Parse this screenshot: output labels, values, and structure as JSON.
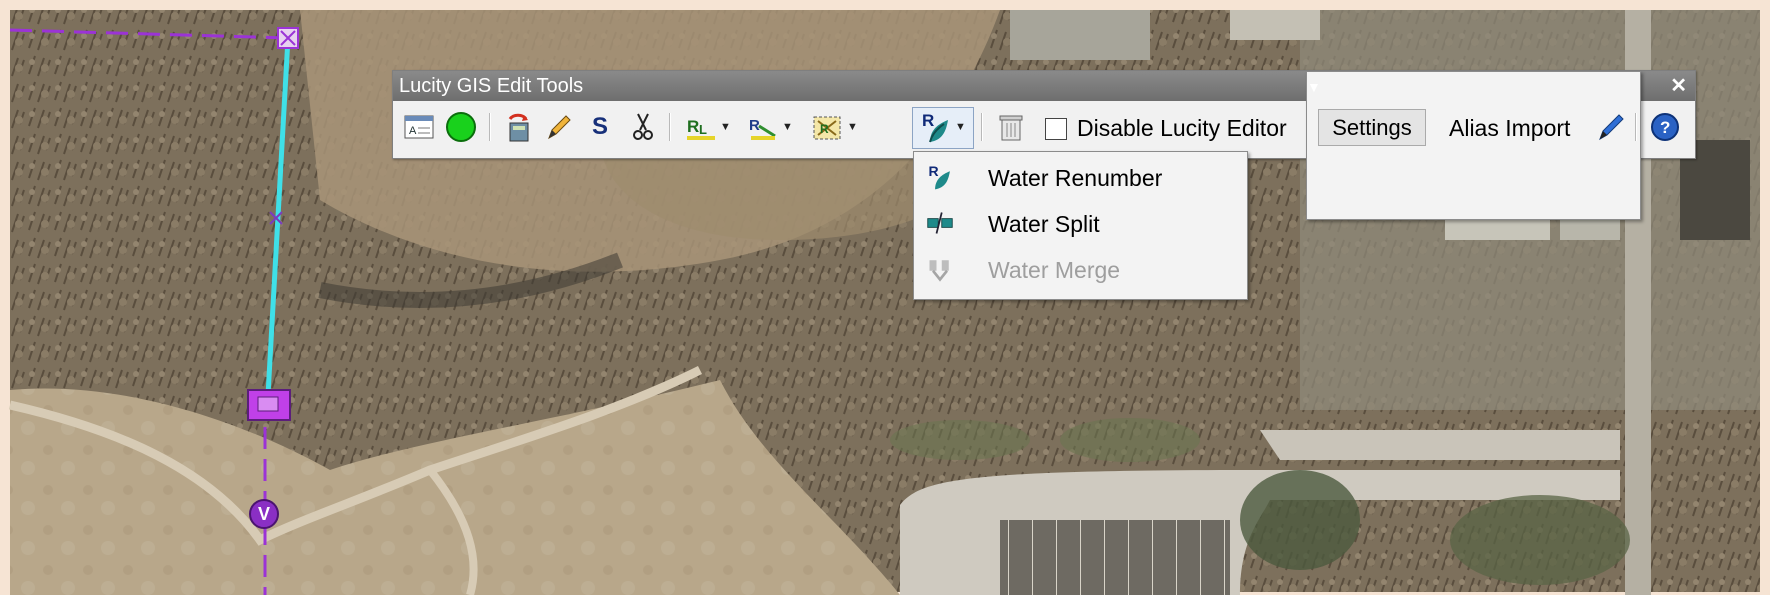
{
  "window": {
    "title": "Lucity GIS Edit Tools",
    "menu_glyph": "▼",
    "close_glyph": "✕"
  },
  "toolbar": {
    "items": [
      {
        "name": "edit-attributes-icon"
      },
      {
        "name": "green-circle-icon"
      },
      {
        "name": "sync-icon"
      },
      {
        "name": "pencil-icon"
      },
      {
        "name": "s-tool",
        "text": "S"
      },
      {
        "name": "scissors-icon"
      },
      {
        "name": "renumber-tool-icon",
        "has_dropdown": true
      },
      {
        "name": "label-tool-icon",
        "has_dropdown": true
      },
      {
        "name": "selection-tool-icon",
        "has_dropdown": true
      },
      {
        "name": "water-tool-icon",
        "has_dropdown": true
      },
      {
        "name": "trash-icon"
      }
    ],
    "disable_label": "Disable Lucity Editor",
    "settings_label": "Settings",
    "alias_import_label": "Alias Import",
    "dropdown_glyph": "▼"
  },
  "dropdown_menu": {
    "items": [
      {
        "label": "Water Renumber",
        "icon": "water-renumber-icon",
        "enabled": true
      },
      {
        "label": "Water Split",
        "icon": "water-split-icon",
        "enabled": true
      },
      {
        "label": "Water Merge",
        "icon": "water-merge-icon",
        "enabled": false
      }
    ]
  },
  "map": {
    "feature_labels": {
      "valve": "V"
    },
    "colors": {
      "main_line": "#3fe0e8",
      "dashed_line": "#9b33d6",
      "feature_box": "#c040e8"
    }
  }
}
